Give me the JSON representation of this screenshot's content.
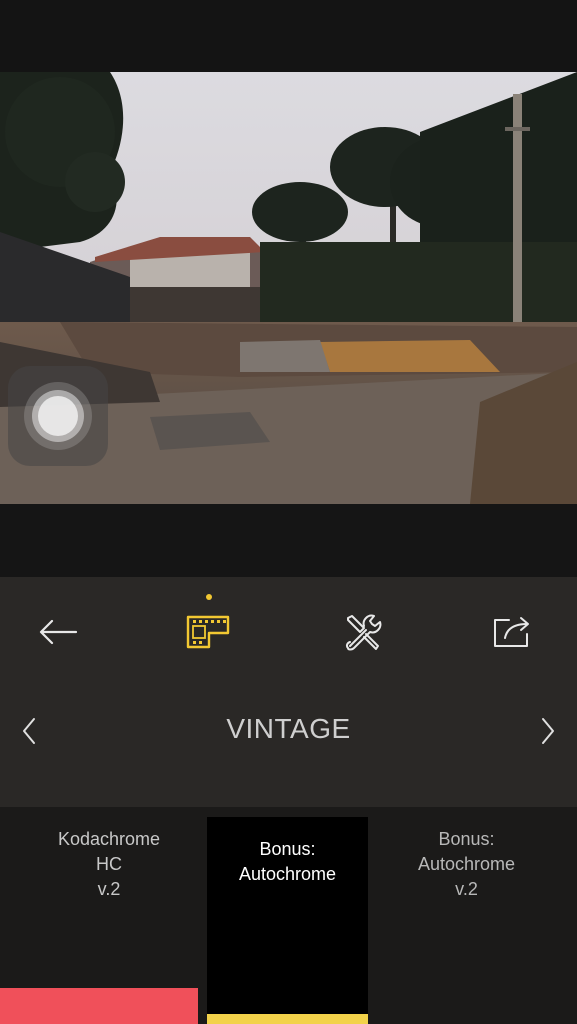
{
  "toolbar": {
    "buttons": [
      {
        "name": "back",
        "icon": "arrow-left-icon"
      },
      {
        "name": "filters",
        "icon": "film-strip-icon",
        "active": true
      },
      {
        "name": "tools",
        "icon": "wrench-screwdriver-icon"
      },
      {
        "name": "share",
        "icon": "share-icon"
      }
    ],
    "accent_color": "#f2c832"
  },
  "category": {
    "title": "VINTAGE",
    "prev_icon": "chevron-left-icon",
    "next_icon": "chevron-right-icon"
  },
  "filters": [
    {
      "label": "Kodachrome\nHC\nv.2",
      "color": "#f0505a"
    },
    {
      "label": "Bonus:\nAutochrome",
      "color": "#f2d24a",
      "selected": true
    },
    {
      "label": "Bonus:\nAutochrome\nv.2"
    }
  ]
}
